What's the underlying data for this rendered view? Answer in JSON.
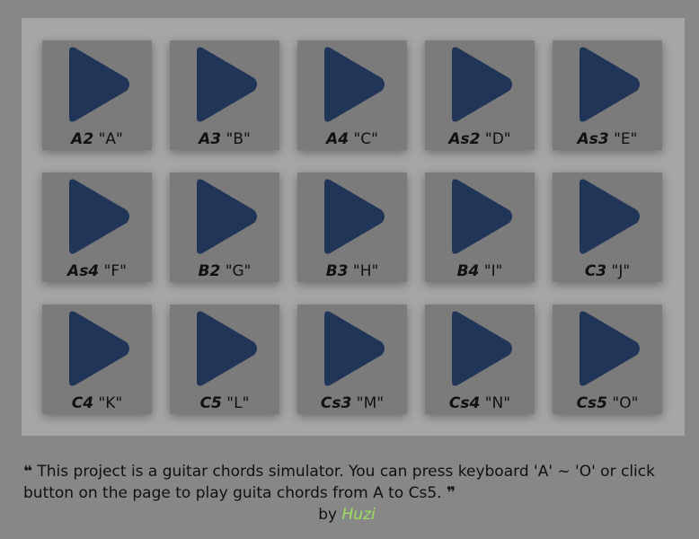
{
  "colors": {
    "background": "#878787",
    "panel": "#a6a6a6",
    "pad": "#7b7b7b",
    "play_icon": "#213558",
    "author_link": "#9be05c"
  },
  "pads": [
    {
      "note": "A2",
      "key": "\"A\"",
      "icon": "play-icon"
    },
    {
      "note": "A3",
      "key": "\"B\"",
      "icon": "play-icon"
    },
    {
      "note": "A4",
      "key": "\"C\"",
      "icon": "play-icon"
    },
    {
      "note": "As2",
      "key": "\"D\"",
      "icon": "play-icon"
    },
    {
      "note": "As3",
      "key": "\"E\"",
      "icon": "play-icon"
    },
    {
      "note": "As4",
      "key": "\"F\"",
      "icon": "play-icon"
    },
    {
      "note": "B2",
      "key": "\"G\"",
      "icon": "play-icon"
    },
    {
      "note": "B3",
      "key": "\"H\"",
      "icon": "play-icon"
    },
    {
      "note": "B4",
      "key": "\"I\"",
      "icon": "play-icon"
    },
    {
      "note": "C3",
      "key": "\"J\"",
      "icon": "play-icon"
    },
    {
      "note": "C4",
      "key": "\"K\"",
      "icon": "play-icon"
    },
    {
      "note": "C5",
      "key": "\"L\"",
      "icon": "play-icon"
    },
    {
      "note": "Cs3",
      "key": "\"M\"",
      "icon": "play-icon"
    },
    {
      "note": "Cs4",
      "key": "\"N\"",
      "icon": "play-icon"
    },
    {
      "note": "Cs5",
      "key": "\"O\"",
      "icon": "play-icon"
    }
  ],
  "footer": {
    "open_quote": "❝",
    "text": "This project is a guitar chords simulator. You can press keyboard 'A' ~ 'O' or click button on the page to play guita chords from A to Cs5.",
    "close_quote": "❞",
    "by": "by",
    "author": "Huzi"
  }
}
